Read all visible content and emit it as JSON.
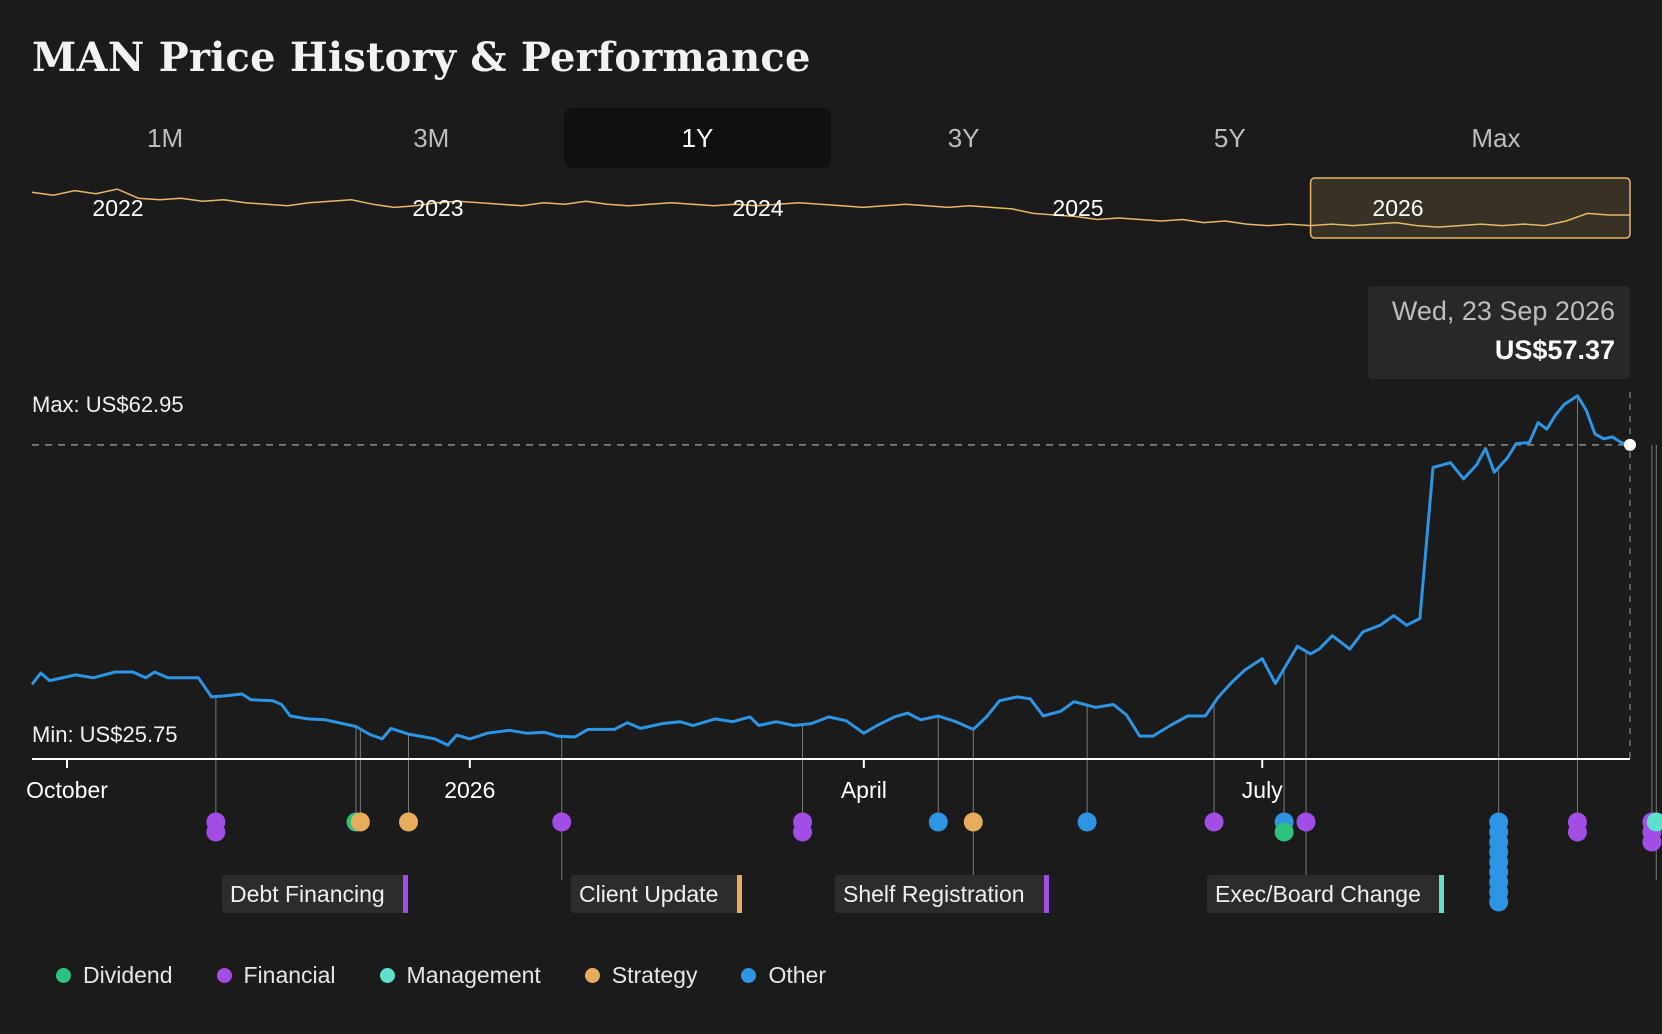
{
  "page": {
    "title": "MAN Price History & Performance"
  },
  "range_tabs": [
    {
      "label": "1M",
      "active": false
    },
    {
      "label": "3M",
      "active": false
    },
    {
      "label": "1Y",
      "active": true
    },
    {
      "label": "3Y",
      "active": false
    },
    {
      "label": "5Y",
      "active": false
    },
    {
      "label": "Max",
      "active": false
    }
  ],
  "tooltip": {
    "date": "Wed, 23 Sep 2026",
    "price": "US$57.37"
  },
  "colors": {
    "price_line": "#2d95e3",
    "overview_line": "#e8b866",
    "Dividend": "#2ec27e",
    "Financial": "#a24ee6",
    "Management": "#5ee0cc",
    "Strategy": "#e8ad5c",
    "Other": "#2d95e3"
  },
  "chart_data": [
    {
      "type": "line",
      "name": "overview",
      "x_labels": [
        "2022",
        "2023",
        "2024",
        "2025",
        "2026"
      ],
      "x_range": [
        "2021-09-23",
        "2026-09-23"
      ],
      "selected_range": [
        "2025-09-23",
        "2026-09-23"
      ],
      "values": [
        52,
        50,
        53,
        51,
        54,
        48,
        47,
        48,
        46,
        47,
        45,
        44,
        43,
        45,
        46,
        47,
        44,
        42,
        43,
        45,
        46,
        45,
        44,
        43,
        45,
        44,
        46,
        44,
        43,
        44,
        45,
        44,
        43,
        44,
        43,
        44,
        45,
        44,
        43,
        42,
        43,
        44,
        43,
        42,
        43,
        42,
        41,
        38,
        37,
        36,
        34,
        35,
        34,
        33,
        34,
        32,
        33,
        31,
        30,
        31,
        30,
        31,
        30,
        31,
        32,
        30,
        29,
        30,
        31,
        30,
        31,
        30,
        33,
        38,
        37,
        37
      ]
    },
    {
      "type": "line",
      "name": "price",
      "x_range": [
        "2025-09-23",
        "2026-09-23"
      ],
      "x_ticks": [
        {
          "date": "2025-10-01",
          "label": "October"
        },
        {
          "date": "2026-01-01",
          "label": "2026"
        },
        {
          "date": "2026-04-01",
          "label": "April"
        },
        {
          "date": "2026-07-01",
          "label": "July"
        }
      ],
      "max_label": "Max: US$62.95",
      "min_label": "Min: US$25.75",
      "ref_line": 57.37,
      "y_range": [
        24.5,
        67.5
      ],
      "points": [
        [
          "2025-09-23",
          32.3
        ],
        [
          "2025-09-25",
          33.5
        ],
        [
          "2025-09-27",
          32.7
        ],
        [
          "2025-10-03",
          33.3
        ],
        [
          "2025-10-07",
          33.0
        ],
        [
          "2025-10-12",
          33.6
        ],
        [
          "2025-10-16",
          33.6
        ],
        [
          "2025-10-19",
          33.0
        ],
        [
          "2025-10-21",
          33.6
        ],
        [
          "2025-10-24",
          33.0
        ],
        [
          "2025-10-28",
          33.0
        ],
        [
          "2025-10-31",
          33.0
        ],
        [
          "2025-11-03",
          31.0
        ],
        [
          "2025-11-06",
          31.1
        ],
        [
          "2025-11-10",
          31.3
        ],
        [
          "2025-11-12",
          30.7
        ],
        [
          "2025-11-17",
          30.6
        ],
        [
          "2025-11-19",
          30.2
        ],
        [
          "2025-11-21",
          29.0
        ],
        [
          "2025-11-25",
          28.7
        ],
        [
          "2025-11-29",
          28.6
        ],
        [
          "2025-12-03",
          28.2
        ],
        [
          "2025-12-06",
          27.9
        ],
        [
          "2025-12-09",
          27.1
        ],
        [
          "2025-12-12",
          26.6
        ],
        [
          "2025-12-14",
          27.7
        ],
        [
          "2025-12-18",
          27.1
        ],
        [
          "2025-12-24",
          26.6
        ],
        [
          "2025-12-27",
          25.95
        ],
        [
          "2025-12-29",
          27.0
        ],
        [
          "2026-01-01",
          26.6
        ],
        [
          "2026-01-05",
          27.2
        ],
        [
          "2026-01-10",
          27.5
        ],
        [
          "2026-01-14",
          27.2
        ],
        [
          "2026-01-18",
          27.3
        ],
        [
          "2026-01-21",
          26.9
        ],
        [
          "2026-01-25",
          26.8
        ],
        [
          "2026-01-28",
          27.6
        ],
        [
          "2026-02-03",
          27.6
        ],
        [
          "2026-02-06",
          28.3
        ],
        [
          "2026-02-09",
          27.7
        ],
        [
          "2026-02-14",
          28.2
        ],
        [
          "2026-02-18",
          28.4
        ],
        [
          "2026-02-21",
          28.0
        ],
        [
          "2026-02-26",
          28.7
        ],
        [
          "2026-03-02",
          28.4
        ],
        [
          "2026-03-06",
          28.9
        ],
        [
          "2026-03-08",
          28.0
        ],
        [
          "2026-03-12",
          28.4
        ],
        [
          "2026-03-16",
          28.0
        ],
        [
          "2026-03-20",
          28.2
        ],
        [
          "2026-03-24",
          28.9
        ],
        [
          "2026-03-28",
          28.5
        ],
        [
          "2025-04-01",
          27.1
        ]
      ]
    }
  ],
  "events": [],
  "event_labels": [
    {
      "label": "Debt Financing",
      "category": "Financial"
    },
    {
      "label": "Client Update",
      "category": "Strategy"
    },
    {
      "label": "Shelf Registration",
      "category": "Financial"
    },
    {
      "label": "Exec/Board Change",
      "category": "Management"
    }
  ],
  "legend": [
    {
      "label": "Dividend",
      "category": "Dividend"
    },
    {
      "label": "Financial",
      "category": "Financial"
    },
    {
      "label": "Management",
      "category": "Management"
    },
    {
      "label": "Strategy",
      "category": "Strategy"
    },
    {
      "label": "Other",
      "category": "Other"
    }
  ]
}
